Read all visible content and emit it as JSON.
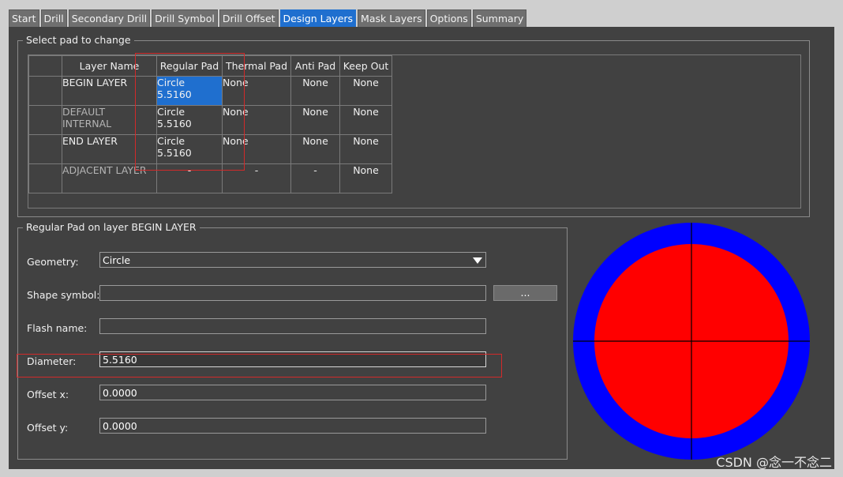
{
  "tabs": [
    "Start",
    "Drill",
    "Secondary Drill",
    "Drill Symbol",
    "Drill Offset",
    "Design Layers",
    "Mask Layers",
    "Options",
    "Summary"
  ],
  "active_tab": "Design Layers",
  "select_group": {
    "title": "Select pad to change",
    "columns": [
      "Layer Name",
      "Regular Pad",
      "Thermal Pad",
      "Anti Pad",
      "Keep Out"
    ],
    "rows": [
      {
        "name": "BEGIN LAYER",
        "regular": "Circle 5.5160",
        "thermal": "None",
        "anti": "None",
        "keepout": "None"
      },
      {
        "name": "DEFAULT INTERNAL",
        "regular": "Circle 5.5160",
        "thermal": "None",
        "anti": "None",
        "keepout": "None"
      },
      {
        "name": "END LAYER",
        "regular": "Circle 5.5160",
        "thermal": "None",
        "anti": "None",
        "keepout": "None"
      },
      {
        "name": "ADJACENT LAYER",
        "regular": "-",
        "thermal": "-",
        "anti": "-",
        "keepout": "None"
      }
    ]
  },
  "pad_group": {
    "title": "Regular Pad on layer BEGIN LAYER",
    "geometry_label": "Geometry:",
    "geometry_value": "Circle",
    "shape_symbol_label": "Shape symbol:",
    "shape_symbol_value": "",
    "browse_label": "...",
    "flash_name_label": "Flash name:",
    "flash_name_value": "",
    "diameter_label": "Diameter:",
    "diameter_value": "5.5160",
    "offset_x_label": "Offset x:",
    "offset_x_value": "0.0000",
    "offset_y_label": "Offset y:",
    "offset_y_value": "0.0000"
  },
  "preview": {
    "outer_color": "#0000ff",
    "inner_color": "#ff0000",
    "crosshair_color": "#000000"
  },
  "watermark": "CSDN @念一不念二"
}
